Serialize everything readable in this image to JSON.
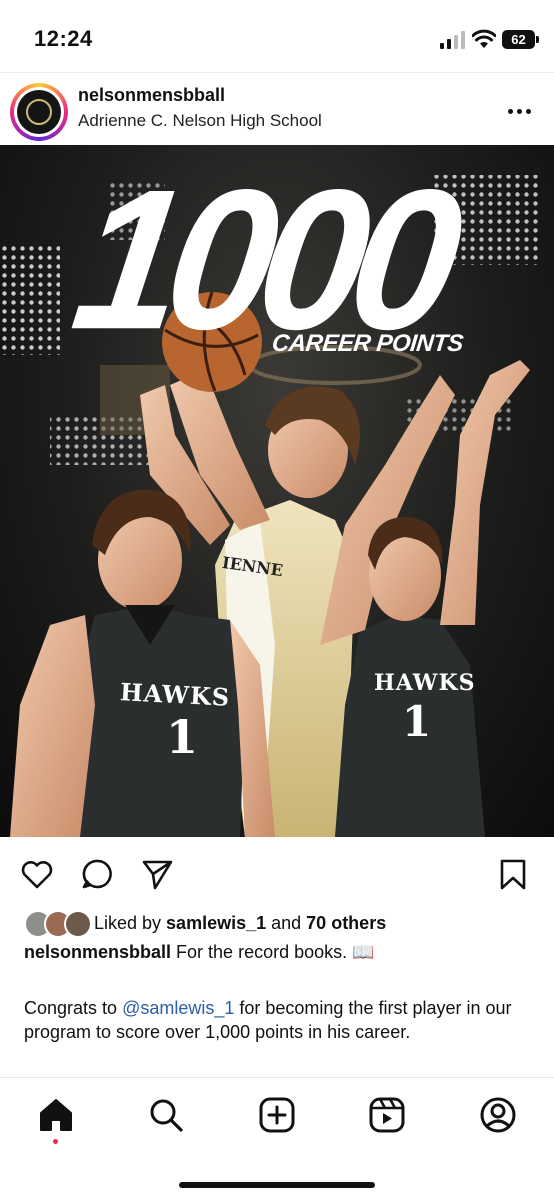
{
  "status_bar": {
    "time": "12:24",
    "battery": "62"
  },
  "post": {
    "username": "nelsonmensbball",
    "subtitle": "Adrienne C. Nelson High School",
    "image": {
      "headline": "1000",
      "subhead": "CAREER POINTS",
      "jersey_text_left": "HAWKS",
      "jersey_number_left": "1",
      "jersey_text_right": "HAWKS",
      "jersey_number_right": "1",
      "jersey_text_center": "IENNE"
    },
    "likes": {
      "prefix": "Liked by ",
      "user": "samlewis_1",
      "middle": " and ",
      "others": "70 others"
    },
    "caption": {
      "user": "nelsonmensbball",
      "text": " For the record books. 📖"
    },
    "caption_body": {
      "prefix": "Congrats to ",
      "mention": "@samlewis_1",
      "suffix": " for becoming the first player in our program to score over 1,000 points in his career."
    }
  },
  "icons": {
    "actions": [
      "heart-icon",
      "comment-icon",
      "share-icon",
      "bookmark-icon"
    ],
    "nav": [
      "home-icon",
      "search-icon",
      "create-icon",
      "reels-icon",
      "profile-icon"
    ]
  }
}
